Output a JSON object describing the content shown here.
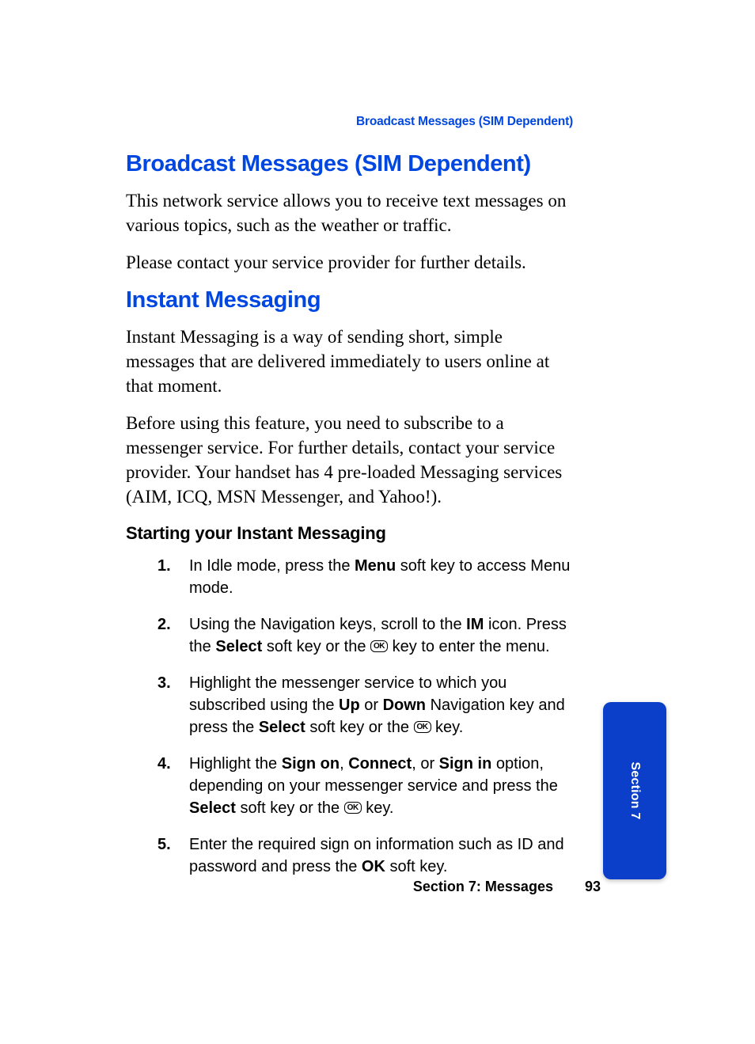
{
  "running_header": "Broadcast Messages (SIM Dependent)",
  "sections": {
    "broadcast": {
      "heading": "Broadcast Messages (SIM Dependent)",
      "p1": "This network service allows you to receive text messages on various topics, such as the weather or traffic.",
      "p2": "Please contact your service provider for further details."
    },
    "im": {
      "heading": "Instant Messaging",
      "p1": "Instant Messaging is a way of sending short, simple messages that are delivered immediately to users online at that moment.",
      "p2": "Before using this feature, you need to subscribe to a messenger service. For further details, contact your service provider. Your handset has 4 pre-loaded Messaging services (AIM, ICQ, MSN Messenger, and Yahoo!).",
      "subheading": "Starting your Instant Messaging",
      "steps": {
        "s1": {
          "num": "1.",
          "a": "In Idle mode, press the ",
          "b1": "Menu",
          "c": " soft key to access Menu mode."
        },
        "s2": {
          "num": "2.",
          "a": "Using the Navigation keys, scroll to the ",
          "b1": "IM",
          "c": " icon. Press the ",
          "b2": "Select",
          "d": " soft key or the ",
          "ok": "OK",
          "e": " key to enter the menu."
        },
        "s3": {
          "num": "3.",
          "a": "Highlight the messenger service to which you subscribed using the ",
          "b1": "Up",
          "c": " or ",
          "b2": "Down",
          "d": " Navigation key and press the ",
          "b3": "Select",
          "e": " soft key or the ",
          "ok": "OK",
          "f": " key."
        },
        "s4": {
          "num": "4.",
          "a": "Highlight the ",
          "b1": "Sign on",
          "c": ", ",
          "b2": "Connect",
          "d": ", or ",
          "b3": "Sign in",
          "e": " option, depending on your messenger service and press the ",
          "b4": "Select",
          "f": " soft key or the ",
          "ok": "OK",
          "g": " key."
        },
        "s5": {
          "num": "5.",
          "a": "Enter the required sign on information such as ID and password and press the ",
          "b1": "OK",
          "c": " soft key."
        }
      }
    }
  },
  "footer": {
    "title": "Section 7: Messages",
    "page": "93"
  },
  "tab": {
    "label": "Section 7"
  },
  "colors": {
    "accent": "#0047e1",
    "tab_bg": "#0b3fc9"
  }
}
